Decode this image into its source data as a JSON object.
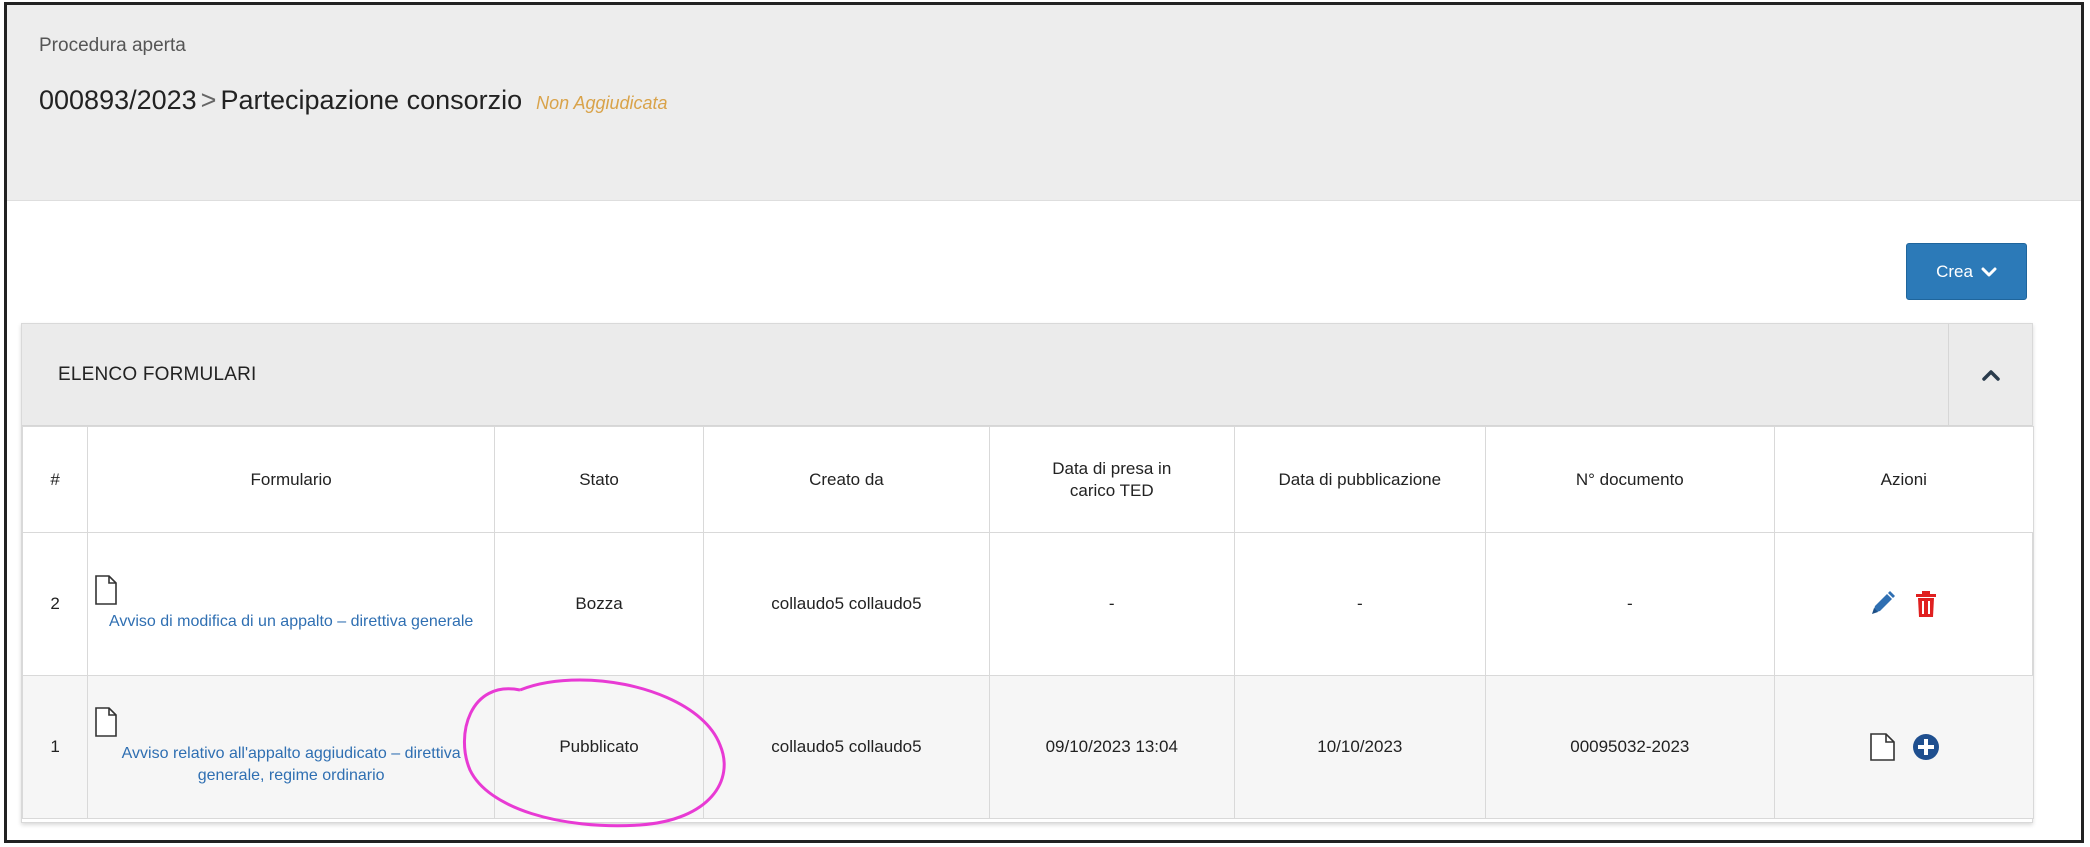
{
  "header": {
    "procedure_type": "Procedura aperta",
    "code": "000893/2023",
    "separator": ">",
    "name": "Partecipazione consorzio",
    "status": "Non Aggiudicata"
  },
  "toolbar": {
    "crea_label": "Crea",
    "crea_icon": "chevron-down-icon"
  },
  "panel": {
    "title": "ELENCO FORMULARI",
    "collapse_icon": "chevron-up-icon"
  },
  "table": {
    "columns": [
      "#",
      "Formulario",
      "Stato",
      "Creato da",
      "Data di presa in carico TED",
      "Data di pubblicazione",
      "N° documento",
      "Azioni"
    ],
    "rows": [
      {
        "num": "2",
        "formulario": "Avviso di modifica di un appalto – direttiva generale",
        "stato": "Bozza",
        "creato_da": "collaudo5 collaudo5",
        "data_ted": "-",
        "data_pub": "-",
        "n_documento": "-",
        "actions": [
          "edit-icon",
          "trash-icon"
        ]
      },
      {
        "num": "1",
        "formulario": "Avviso relativo all'appalto aggiudicato – direttiva generale, regime ordinario",
        "stato": "Pubblicato",
        "creato_da": "collaudo5 collaudo5",
        "data_ted": "09/10/2023 13:04",
        "data_pub": "10/10/2023",
        "n_documento": "00095032-2023",
        "actions": [
          "document-icon",
          "plus-circle-icon"
        ]
      }
    ]
  },
  "colors": {
    "primary_button": "#2c7ab8",
    "link": "#2f6fb2",
    "status_warning": "#d9a34a",
    "status_published": "#2e8b3e",
    "delete": "#e02020",
    "annotation": "#e83ad4"
  }
}
